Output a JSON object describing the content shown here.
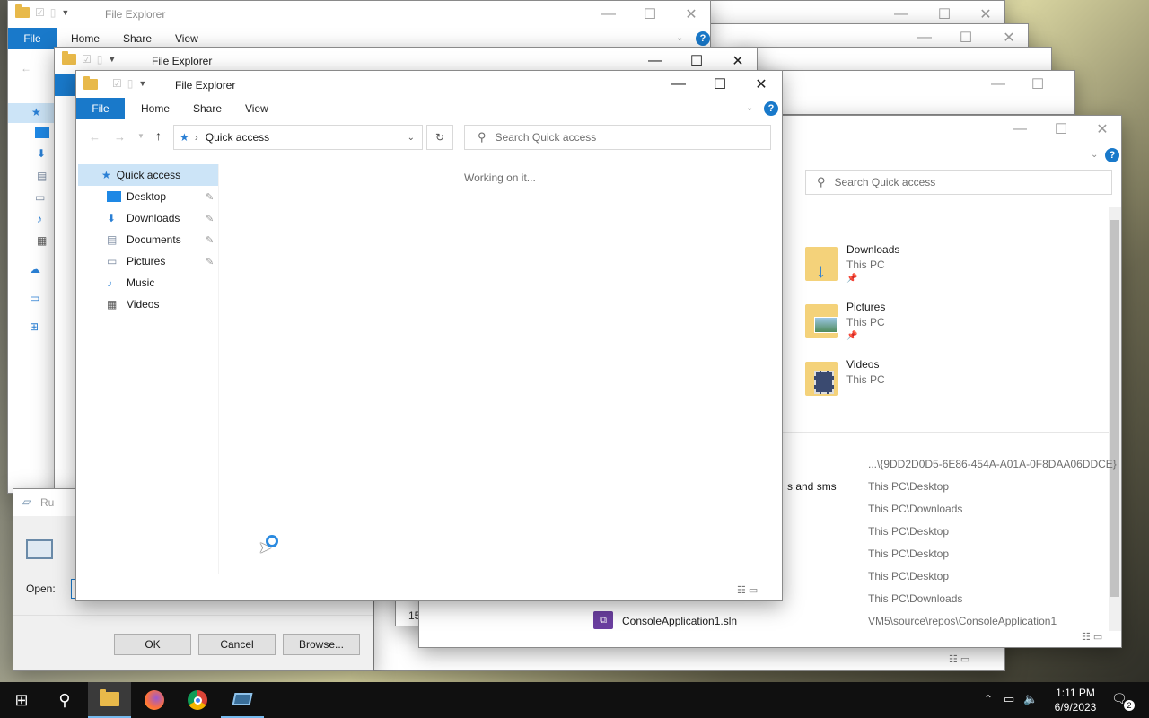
{
  "app_title": "File Explorer",
  "ribbon": {
    "file": "File",
    "home": "Home",
    "share": "Share",
    "view": "View"
  },
  "address": {
    "location": "Quick access"
  },
  "search": {
    "placeholder": "Search Quick access"
  },
  "status": {
    "working": "Working on it..."
  },
  "navpane": {
    "quick_access": "Quick access",
    "items": [
      {
        "label": "Desktop",
        "pinned": true
      },
      {
        "label": "Downloads",
        "pinned": true
      },
      {
        "label": "Documents",
        "pinned": true
      },
      {
        "label": "Pictures",
        "pinned": true
      },
      {
        "label": "Music",
        "pinned": false
      },
      {
        "label": "Videos",
        "pinned": false
      }
    ]
  },
  "back_window": {
    "folders": [
      {
        "name": "Downloads",
        "location": "This PC"
      },
      {
        "name": "Pictures",
        "location": "This PC"
      },
      {
        "name": "Videos",
        "location": "This PC"
      }
    ],
    "recent_fragment": "s and sms",
    "recent_paths": [
      "...\\{9DD2D0D5-6E86-454A-A01A-0F8DAA06DDCE}",
      "This PC\\Desktop",
      "This PC\\Downloads",
      "This PC\\Desktop",
      "This PC\\Desktop",
      "This PC\\Desktop",
      "This PC\\Downloads",
      "VM5\\source\\repos\\ConsoleApplication1"
    ],
    "recent_file": "ConsoleApplication1.sln",
    "partial_num": "15"
  },
  "run_dialog": {
    "title_fragment": "Ru",
    "open_label": "Open:",
    "ok": "OK",
    "cancel": "Cancel",
    "browse": "Browse..."
  },
  "taskbar": {
    "time": "1:11 PM",
    "date": "6/9/2023"
  },
  "colors": {
    "accent": "#1979ca",
    "taskbar": "#101010"
  }
}
